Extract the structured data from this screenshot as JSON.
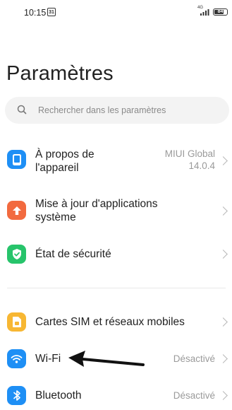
{
  "status_bar": {
    "time": "10:15",
    "calendar_badge": "31",
    "network": "4G",
    "battery": "84"
  },
  "page": {
    "title": "Paramètres"
  },
  "search": {
    "placeholder": "Rechercher dans les paramètres"
  },
  "settings": [
    {
      "label": "À propos de\nl'appareil",
      "value": "MIUI Global\n14.0.4",
      "icon": "phone-icon",
      "color": "#1e8ff5"
    },
    {
      "label": "Mise à jour d'applications\nsystème",
      "value": "",
      "icon": "arrow-up-icon",
      "color": "#f26a3f"
    },
    {
      "label": "État de sécurité",
      "value": "",
      "icon": "shield-check-icon",
      "color": "#27c46b"
    },
    {
      "label": "Cartes SIM et réseaux mobiles",
      "value": "",
      "icon": "sim-card-icon",
      "color": "#f7b733"
    },
    {
      "label": "Wi-Fi",
      "value": "Désactivé",
      "icon": "wifi-icon",
      "color": "#1e8ff5"
    },
    {
      "label": "Bluetooth",
      "value": "Désactivé",
      "icon": "bluetooth-icon",
      "color": "#1e8ff5"
    }
  ]
}
